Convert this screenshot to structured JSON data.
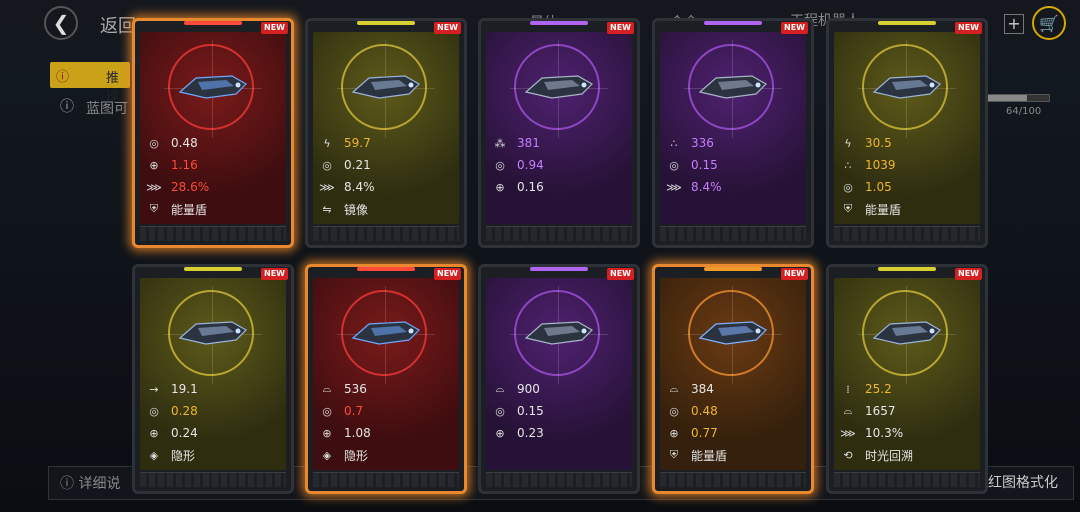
{
  "header": {
    "back_icon": "chevron-left-icon",
    "back_label": "返回",
    "plus_label": "+",
    "cart_icon": "shopping-cart-icon",
    "bg_text_1": "星体",
    "bg_text_2": "合金",
    "bg_text_3": "工程机器人"
  },
  "warning_tab": {
    "icon": "alert-icon",
    "label": "推理"
  },
  "info_line": {
    "icon": "info-icon",
    "text": "蓝图可"
  },
  "progress": {
    "value": 64,
    "max": 100,
    "text": "64/100"
  },
  "bottom": {
    "left_text": "详细说",
    "right_text": "红图格式化",
    "left_icon": "info-icon"
  },
  "badge_text": "NEW",
  "colors": {
    "red": "#ff4a3a",
    "yellow": "#f0b62e",
    "purple": "#c77dff",
    "white": "#e6e6e6",
    "glow": "#e8892f"
  },
  "cards": [
    {
      "tier": "red",
      "glow": true,
      "stats": [
        {
          "icon": "target-circle-icon",
          "value": "0.48",
          "color": "white"
        },
        {
          "icon": "crosshair-icon",
          "value": "1.16",
          "color": "red"
        },
        {
          "icon": "missile-volley-icon",
          "value": "28.6%",
          "color": "red"
        },
        {
          "icon": "shield-icon",
          "value": "能量盾",
          "color": "white"
        }
      ]
    },
    {
      "tier": "olive",
      "glow": false,
      "stats": [
        {
          "icon": "lightning-icon",
          "value": "59.7",
          "color": "yellow"
        },
        {
          "icon": "target-circle-icon",
          "value": "0.21",
          "color": "white"
        },
        {
          "icon": "missile-volley-icon",
          "value": "8.4%",
          "color": "white"
        },
        {
          "icon": "mirror-icon",
          "value": "镜像",
          "color": "white"
        }
      ]
    },
    {
      "tier": "purple",
      "glow": false,
      "stats": [
        {
          "icon": "burst-icon",
          "value": "381",
          "color": "purple"
        },
        {
          "icon": "target-circle-icon",
          "value": "0.94",
          "color": "purple"
        },
        {
          "icon": "crosshair-icon",
          "value": "0.16",
          "color": "white"
        }
      ]
    },
    {
      "tier": "purple",
      "glow": false,
      "stats": [
        {
          "icon": "triple-dot-icon",
          "value": "336",
          "color": "purple"
        },
        {
          "icon": "target-circle-icon",
          "value": "0.15",
          "color": "purple"
        },
        {
          "icon": "missile-volley-icon",
          "value": "8.4%",
          "color": "purple"
        }
      ]
    },
    {
      "tier": "olive",
      "glow": false,
      "stats": [
        {
          "icon": "lightning-icon",
          "value": "30.5",
          "color": "yellow"
        },
        {
          "icon": "triple-dot-icon",
          "value": "1039",
          "color": "yellow"
        },
        {
          "icon": "target-circle-icon",
          "value": "1.05",
          "color": "yellow"
        },
        {
          "icon": "shield-icon",
          "value": "能量盾",
          "color": "white"
        }
      ]
    },
    {
      "tier": "olive",
      "glow": false,
      "stats": [
        {
          "icon": "arrow-right-icon",
          "value": "19.1",
          "color": "white"
        },
        {
          "icon": "target-circle-icon",
          "value": "0.28",
          "color": "yellow"
        },
        {
          "icon": "crosshair-icon",
          "value": "0.24",
          "color": "white"
        },
        {
          "icon": "cloak-icon",
          "value": "隐形",
          "color": "white"
        }
      ]
    },
    {
      "tier": "red",
      "glow": true,
      "stats": [
        {
          "icon": "radar-dome-icon",
          "value": "536",
          "color": "white"
        },
        {
          "icon": "target-circle-icon",
          "value": "0.7",
          "color": "red"
        },
        {
          "icon": "crosshair-icon",
          "value": "1.08",
          "color": "white"
        },
        {
          "icon": "cloak-icon",
          "value": "隐形",
          "color": "white"
        }
      ]
    },
    {
      "tier": "purple",
      "glow": false,
      "stats": [
        {
          "icon": "radar-dome-icon",
          "value": "900",
          "color": "white"
        },
        {
          "icon": "target-circle-icon",
          "value": "0.15",
          "color": "white"
        },
        {
          "icon": "crosshair-icon",
          "value": "0.23",
          "color": "white"
        }
      ]
    },
    {
      "tier": "orange",
      "glow": true,
      "stats": [
        {
          "icon": "radar-dome-icon",
          "value": "384",
          "color": "white"
        },
        {
          "icon": "target-circle-icon",
          "value": "0.48",
          "color": "yellow"
        },
        {
          "icon": "crosshair-icon",
          "value": "0.77",
          "color": "yellow"
        },
        {
          "icon": "shield-icon",
          "value": "能量盾",
          "color": "white"
        }
      ]
    },
    {
      "tier": "olive",
      "glow": false,
      "stats": [
        {
          "icon": "ammo-icon",
          "value": "25.2",
          "color": "yellow"
        },
        {
          "icon": "radar-dome-icon",
          "value": "1657",
          "color": "white"
        },
        {
          "icon": "missile-volley-icon",
          "value": "10.3%",
          "color": "white"
        },
        {
          "icon": "time-rewind-icon",
          "value": "时光回溯",
          "color": "white"
        }
      ]
    }
  ]
}
